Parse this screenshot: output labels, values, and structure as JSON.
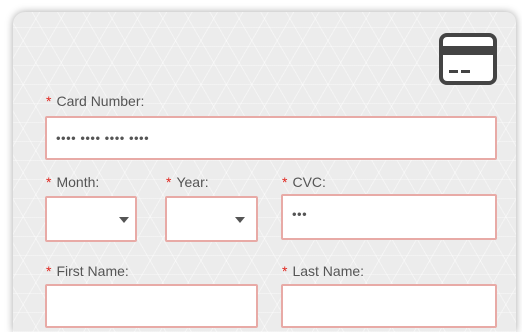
{
  "card_icon": "credit-card-icon",
  "required_mark": "*",
  "card_number": {
    "label": "Card Number:",
    "value": "•••• •••• •••• ••••"
  },
  "month": {
    "label": "Month:",
    "value": ""
  },
  "year": {
    "label": "Year:",
    "value": ""
  },
  "cvc": {
    "label": "CVC:",
    "value": "•••"
  },
  "first_name": {
    "label": "First Name:",
    "value": ""
  },
  "last_name": {
    "label": "Last Name:",
    "value": ""
  },
  "colors": {
    "required": "#e0261f",
    "field_border": "#e8aaa6",
    "panel": "#ececec",
    "label": "#555555"
  }
}
